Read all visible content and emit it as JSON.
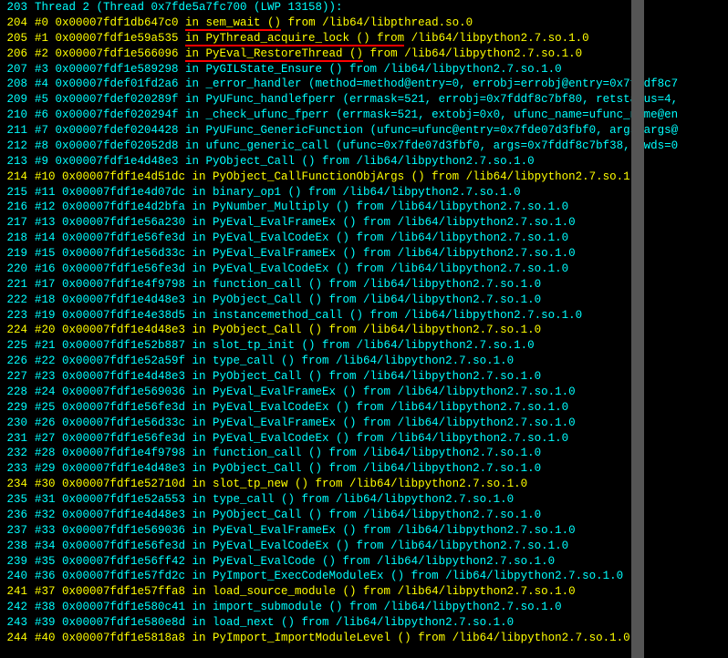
{
  "lines": [
    {
      "num": "203",
      "hl": false,
      "text": "Thread 2 (Thread 0x7fde5a7fc700 (LWP 13158)):",
      "red": null
    },
    {
      "num": "204",
      "hl": true,
      "pre": "#0  0x00007fdf1db647c0 ",
      "red": "in sem_wait ()",
      "post": " from /lib64/libpthread.so.0"
    },
    {
      "num": "205",
      "hl": true,
      "pre": "#1  0x00007fdf1e59a535 ",
      "red": "in PyThread_acquire_lock () from",
      "post": " /lib64/libpython2.7.so.1.0"
    },
    {
      "num": "206",
      "hl": true,
      "pre": "#2  0x00007fdf1e566096 ",
      "red": "in PyEval_RestoreThread ()",
      "post": " from /lib64/libpython2.7.so.1.0"
    },
    {
      "num": "207",
      "hl": false,
      "text": "#3  0x00007fdf1e589298 in PyGILState_Ensure () from /lib64/libpython2.7.so.1.0",
      "red": null
    },
    {
      "num": "208",
      "hl": false,
      "text": "#4  0x00007fdef01fd2a6 in _error_handler (method=method@entry=0, errobj=errobj@entry=0x7fddf8c7",
      "red": null
    },
    {
      "num": "209",
      "hl": false,
      "text": "#5  0x00007fdef020289f in PyUFunc_handlefperr (errmask=521, errobj=0x7fddf8c7bf80, retstatus=4,",
      "red": null
    },
    {
      "num": "210",
      "hl": false,
      "text": "#6  0x00007fdef020294f in _check_ufunc_fperr (errmask=521, extobj=0x0, ufunc_name=ufunc_name@en",
      "red": null
    },
    {
      "num": "211",
      "hl": false,
      "text": "#7  0x00007fdef0204428 in PyUFunc_GenericFunction (ufunc=ufunc@entry=0x7fde07d3fbf0, args=args@",
      "red": null
    },
    {
      "num": "212",
      "hl": false,
      "text": "#8  0x00007fdef02052d8 in ufunc_generic_call (ufunc=0x7fde07d3fbf0, args=0x7fddf8c7bf38, kwds=0",
      "red": null
    },
    {
      "num": "213",
      "hl": false,
      "text": "#9  0x00007fdf1e4d48e3 in PyObject_Call () from /lib64/libpython2.7.so.1.0",
      "red": null
    },
    {
      "num": "214",
      "hl": true,
      "text": "#10 0x00007fdf1e4d51dc in PyObject_CallFunctionObjArgs () from /lib64/libpython2.7.so.1.0",
      "red": null
    },
    {
      "num": "215",
      "hl": false,
      "text": "#11 0x00007fdf1e4d07dc in binary_op1 () from /lib64/libpython2.7.so.1.0",
      "red": null
    },
    {
      "num": "216",
      "hl": false,
      "text": "#12 0x00007fdf1e4d2bfa in PyNumber_Multiply () from /lib64/libpython2.7.so.1.0",
      "red": null
    },
    {
      "num": "217",
      "hl": false,
      "text": "#13 0x00007fdf1e56a230 in PyEval_EvalFrameEx () from /lib64/libpython2.7.so.1.0",
      "red": null
    },
    {
      "num": "218",
      "hl": false,
      "text": "#14 0x00007fdf1e56fe3d in PyEval_EvalCodeEx () from /lib64/libpython2.7.so.1.0",
      "red": null
    },
    {
      "num": "219",
      "hl": false,
      "text": "#15 0x00007fdf1e56d33c in PyEval_EvalFrameEx () from /lib64/libpython2.7.so.1.0",
      "red": null
    },
    {
      "num": "220",
      "hl": false,
      "text": "#16 0x00007fdf1e56fe3d in PyEval_EvalCodeEx () from /lib64/libpython2.7.so.1.0",
      "red": null
    },
    {
      "num": "221",
      "hl": false,
      "text": "#17 0x00007fdf1e4f9798 in function_call () from /lib64/libpython2.7.so.1.0",
      "red": null
    },
    {
      "num": "222",
      "hl": false,
      "text": "#18 0x00007fdf1e4d48e3 in PyObject_Call () from /lib64/libpython2.7.so.1.0",
      "red": null
    },
    {
      "num": "223",
      "hl": false,
      "text": "#19 0x00007fdf1e4e38d5 in instancemethod_call () from /lib64/libpython2.7.so.1.0",
      "red": null
    },
    {
      "num": "224",
      "hl": true,
      "text": "#20 0x00007fdf1e4d48e3 in PyObject_Call () from /lib64/libpython2.7.so.1.0",
      "red": null
    },
    {
      "num": "225",
      "hl": false,
      "text": "#21 0x00007fdf1e52b887 in slot_tp_init () from /lib64/libpython2.7.so.1.0",
      "red": null
    },
    {
      "num": "226",
      "hl": false,
      "text": "#22 0x00007fdf1e52a59f in type_call () from /lib64/libpython2.7.so.1.0",
      "red": null
    },
    {
      "num": "227",
      "hl": false,
      "text": "#23 0x00007fdf1e4d48e3 in PyObject_Call () from /lib64/libpython2.7.so.1.0",
      "red": null
    },
    {
      "num": "228",
      "hl": false,
      "text": "#24 0x00007fdf1e569036 in PyEval_EvalFrameEx () from /lib64/libpython2.7.so.1.0",
      "red": null
    },
    {
      "num": "229",
      "hl": false,
      "text": "#25 0x00007fdf1e56fe3d in PyEval_EvalCodeEx () from /lib64/libpython2.7.so.1.0",
      "red": null
    },
    {
      "num": "230",
      "hl": false,
      "text": "#26 0x00007fdf1e56d33c in PyEval_EvalFrameEx () from /lib64/libpython2.7.so.1.0",
      "red": null
    },
    {
      "num": "231",
      "hl": false,
      "text": "#27 0x00007fdf1e56fe3d in PyEval_EvalCodeEx () from /lib64/libpython2.7.so.1.0",
      "red": null
    },
    {
      "num": "232",
      "hl": false,
      "text": "#28 0x00007fdf1e4f9798 in function_call () from /lib64/libpython2.7.so.1.0",
      "red": null
    },
    {
      "num": "233",
      "hl": false,
      "text": "#29 0x00007fdf1e4d48e3 in PyObject_Call () from /lib64/libpython2.7.so.1.0",
      "red": null
    },
    {
      "num": "234",
      "hl": true,
      "text": "#30 0x00007fdf1e52710d in slot_tp_new () from /lib64/libpython2.7.so.1.0",
      "red": null
    },
    {
      "num": "235",
      "hl": false,
      "text": "#31 0x00007fdf1e52a553 in type_call () from /lib64/libpython2.7.so.1.0",
      "red": null
    },
    {
      "num": "236",
      "hl": false,
      "text": "#32 0x00007fdf1e4d48e3 in PyObject_Call () from /lib64/libpython2.7.so.1.0",
      "red": null
    },
    {
      "num": "237",
      "hl": false,
      "text": "#33 0x00007fdf1e569036 in PyEval_EvalFrameEx () from /lib64/libpython2.7.so.1.0",
      "red": null
    },
    {
      "num": "238",
      "hl": false,
      "text": "#34 0x00007fdf1e56fe3d in PyEval_EvalCodeEx () from /lib64/libpython2.7.so.1.0",
      "red": null
    },
    {
      "num": "239",
      "hl": false,
      "text": "#35 0x00007fdf1e56ff42 in PyEval_EvalCode () from /lib64/libpython2.7.so.1.0",
      "red": null
    },
    {
      "num": "240",
      "hl": false,
      "text": "#36 0x00007fdf1e57fd2c in PyImport_ExecCodeModuleEx () from /lib64/libpython2.7.so.1.0",
      "red": null
    },
    {
      "num": "241",
      "hl": true,
      "text": "#37 0x00007fdf1e57ffa8 in load_source_module () from /lib64/libpython2.7.so.1.0",
      "red": null
    },
    {
      "num": "242",
      "hl": false,
      "text": "#38 0x00007fdf1e580c41 in import_submodule () from /lib64/libpython2.7.so.1.0",
      "red": null
    },
    {
      "num": "243",
      "hl": false,
      "text": "#39 0x00007fdf1e580e8d in load_next () from /lib64/libpython2.7.so.1.0",
      "red": null
    },
    {
      "num": "244",
      "hl": true,
      "text": "#40 0x00007fdf1e5818a8 in PyImport_ImportModuleLevel () from /lib64/libpython2.7.so.1.0",
      "red": null
    }
  ]
}
